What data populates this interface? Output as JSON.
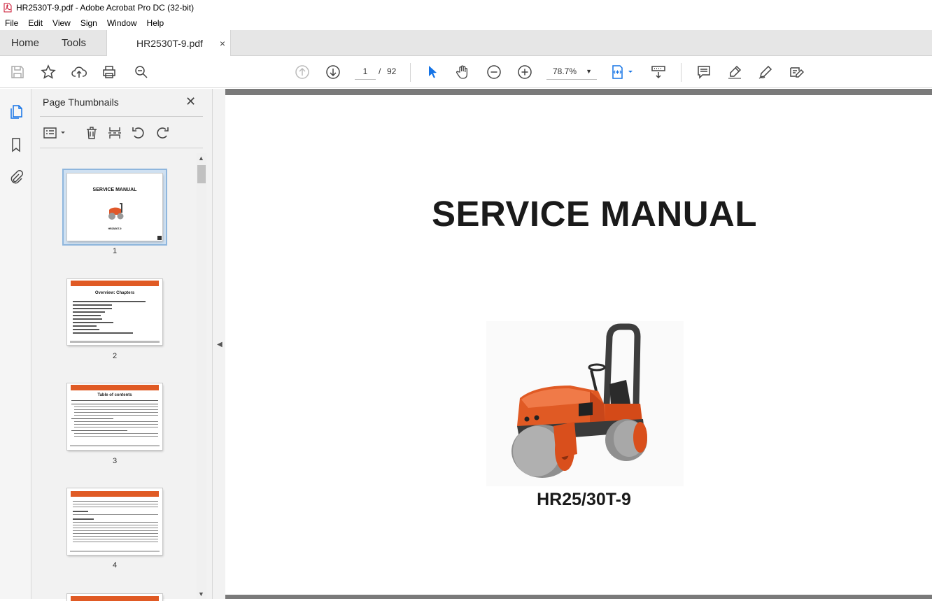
{
  "window": {
    "title": "HR2530T-9.pdf - Adobe Acrobat Pro DC (32-bit)"
  },
  "menu": [
    "File",
    "Edit",
    "View",
    "Sign",
    "Window",
    "Help"
  ],
  "tabs": {
    "home": "Home",
    "tools": "Tools",
    "document": "HR2530T-9.pdf",
    "close": "×"
  },
  "toolbar": {
    "current_page": "1",
    "page_separator": "/",
    "total_pages": "92",
    "zoom": "78.7%",
    "icons": [
      "save-icon",
      "star-icon",
      "upload-icon",
      "print-icon",
      "search-icon",
      "page-up-icon",
      "page-down-icon",
      "select-cursor-icon",
      "hand-icon",
      "zoom-out-icon",
      "zoom-in-icon",
      "fit-page-icon",
      "scroll-mode-icon",
      "comment-icon",
      "highlight-icon",
      "draw-icon",
      "fill-sign-icon"
    ]
  },
  "left_rail": {
    "icons": [
      "page-thumbnails-icon",
      "bookmark-icon",
      "attachment-icon"
    ]
  },
  "panel": {
    "title": "Page Thumbnails",
    "close": "✕",
    "thumbnails": [
      {
        "num": "1",
        "title": "SERVICE MANUAL",
        "caption": "HR25/30T-9"
      },
      {
        "num": "2",
        "title": "Overview: Chapters"
      },
      {
        "num": "3",
        "title": "Table of contents"
      },
      {
        "num": "4"
      }
    ]
  },
  "document": {
    "title": "SERVICE MANUAL",
    "model": "HR25/30T-9"
  },
  "colors": {
    "accent_orange": "#e05a24",
    "selection_blue": "#8fb6dd",
    "canvas_gray": "#7a7a7a"
  }
}
